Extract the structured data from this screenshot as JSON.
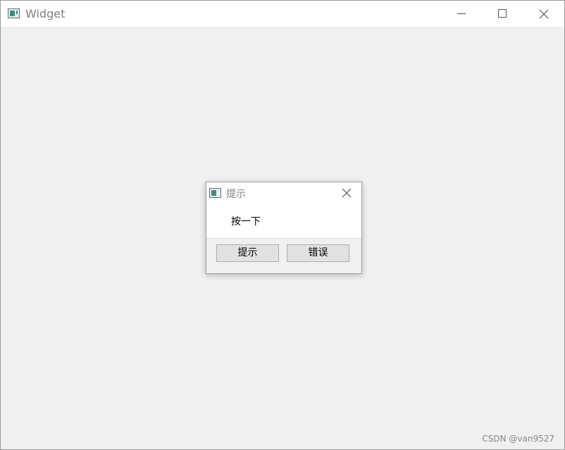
{
  "window": {
    "title": "Widget",
    "icon": "app-window-icon",
    "controls": [
      "minimize",
      "maximize",
      "close"
    ]
  },
  "dialog": {
    "title": "提示",
    "message": "按一下",
    "buttons": {
      "hint_label": "提示",
      "error_label": "错误"
    }
  },
  "watermark": "CSDN @van9527"
}
